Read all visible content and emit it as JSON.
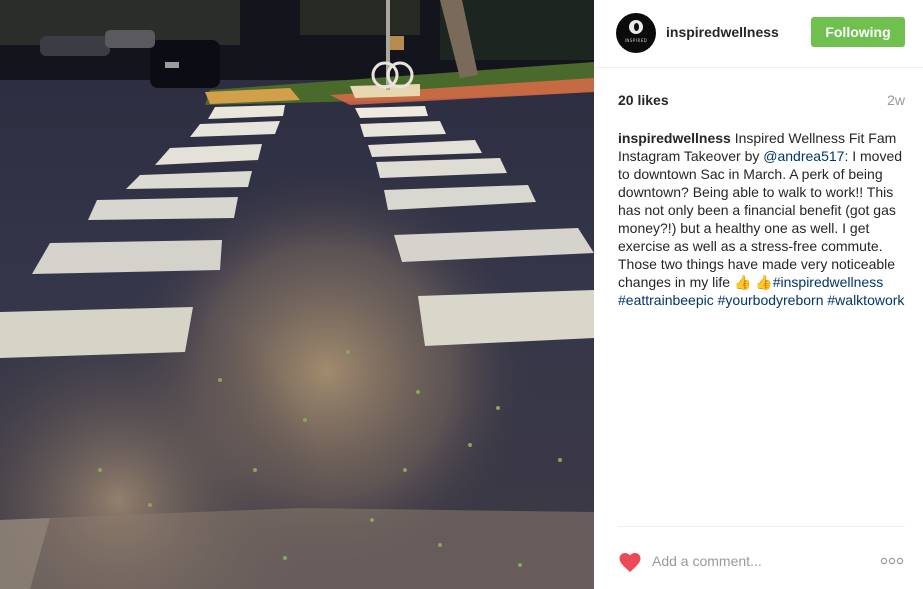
{
  "post": {
    "image_alt": "Sunlit crosswalk on a shaded street"
  },
  "header": {
    "avatar_text": "INSPIRED",
    "username": "inspiredwellness",
    "follow_label": "Following",
    "follow_color": "#70c050"
  },
  "meta": {
    "likes": "20 likes",
    "age": "2w"
  },
  "caption": {
    "author": "inspiredwellness",
    "text_1": " Inspired Wellness Fit Fam Instagram Takeover by ",
    "mention": "@andrea517",
    "text_2": ": I moved to downtown Sac in March. A perk of being downtown? Being able to walk to work!! This has not only been a financial benefit (got gas money?!) but a healthy one as well. I get exercise as well as a stress-free commute. Those two things have made very noticeable changes in my life ",
    "emoji_1": "👍",
    "emoji_2": "👍",
    "hashtags": [
      "#inspiredwellness",
      "#eattrainbeepic",
      "#yourbodyreborn",
      "#walktowork"
    ],
    "link_color": "#003569"
  },
  "footer": {
    "heart_icon": "heart-icon",
    "heart_color": "#ed4956",
    "comment_placeholder": "Add a comment...",
    "more_icon": "more-options-icon"
  }
}
